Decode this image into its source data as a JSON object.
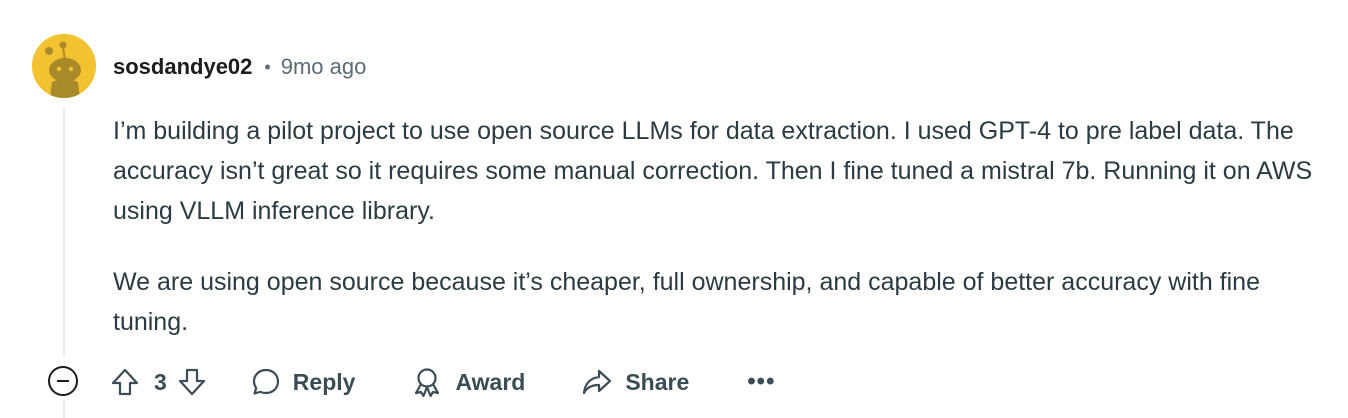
{
  "comment": {
    "username": "sosdandye02",
    "separator": "•",
    "time": "9mo ago",
    "paragraphs": [
      "I’m building a pilot project to use open source LLMs for data extraction. I used GPT-4 to pre label data. The accuracy isn’t great so it requires some manual correction. Then I fine tuned a mistral 7b. Running it on AWS using VLLM inference library.",
      "We are using open source because it’s cheaper, full ownership, and capable of better accuracy with fine tuning."
    ]
  },
  "actions": {
    "score": "3",
    "reply_label": "Reply",
    "award_label": "Award",
    "share_label": "Share",
    "more_label": "•••"
  },
  "icons": {
    "avatar": "snoo-avatar-icon",
    "collapse": "collapse-minus-icon",
    "upvote": "upvote-arrow-icon",
    "downvote": "downvote-arrow-icon",
    "reply": "speech-bubble-icon",
    "award": "award-ribbon-icon",
    "share": "share-arrow-icon",
    "more": "more-options-icon"
  },
  "colors": {
    "avatar_bg": "#f2c230",
    "text": "#2a3c42",
    "meta": "#5c6c74",
    "action": "#3a4d55"
  }
}
